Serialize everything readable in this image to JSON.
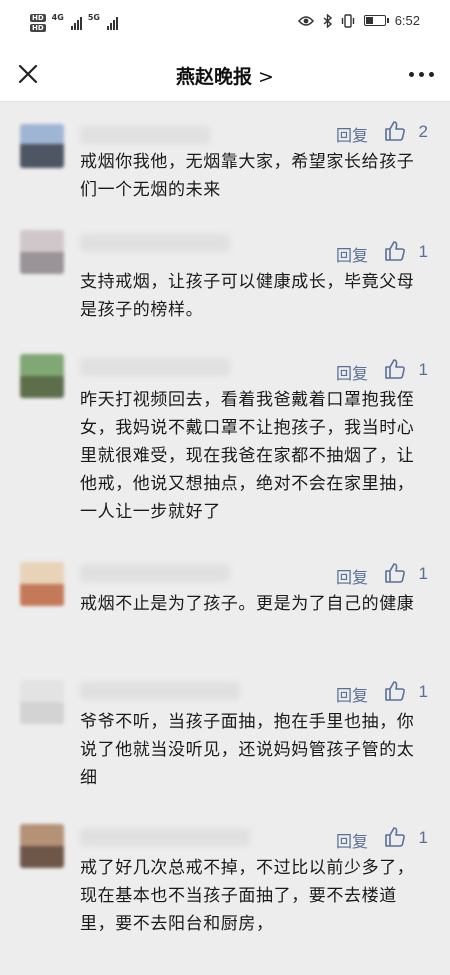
{
  "status": {
    "time": "6:52",
    "net_a": "4G",
    "net_b": "5G"
  },
  "nav": {
    "title": "燕赵晚报",
    "chevron": ">"
  },
  "colors": {
    "accent": "#5a6f95"
  },
  "comments": [
    {
      "reply_label": "回复",
      "likes": "2",
      "text": "戒烟你我他，无烟靠大家，希望家长给孩子们一个无烟的未来"
    },
    {
      "reply_label": "回复",
      "likes": "1",
      "text": "支持戒烟，让孩子可以健康成长，毕竟父母是孩子的榜样。"
    },
    {
      "reply_label": "回复",
      "likes": "1",
      "text": "昨天打视频回去，看着我爸戴着口罩抱我侄女，我妈说不戴口罩不让抱孩子，我当时心里就很难受，现在我爸在家都不抽烟了，让他戒，他说又想抽点，绝对不会在家里抽，一人让一步就好了"
    },
    {
      "reply_label": "回复",
      "likes": "1",
      "text": "戒烟不止是为了孩子。更是为了自己的健康"
    },
    {
      "reply_label": "回复",
      "likes": "1",
      "text": "爷爷不听，当孩子面抽，抱在手里也抽，你说了他就当没听见，还说妈妈管孩子管的太细"
    },
    {
      "reply_label": "回复",
      "likes": "1",
      "text": "戒了好几次总戒不掉，不过比以前少多了，现在基本也不当孩子面抽了，要不去楼道里，要不去阳台和厨房，"
    }
  ]
}
